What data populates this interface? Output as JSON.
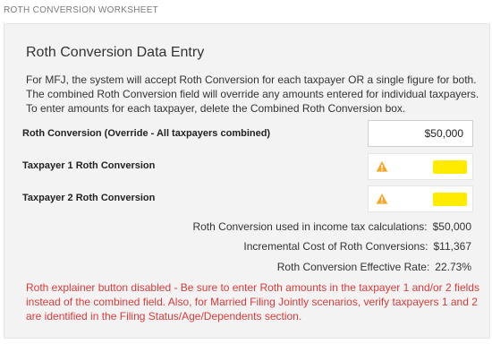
{
  "header": {
    "worksheet_title": "ROTH CONVERSION WORKSHEET"
  },
  "panel": {
    "title": "Roth Conversion Data Entry",
    "intro_lines": [
      "For MFJ, the system will accept Roth Conversion for each taxpayer OR a single figure for both.",
      "The combined Roth Conversion field will override any amounts entered for individual taxpayers.",
      "To enter amounts for each taxpayer, delete the Combined Roth Conversion box."
    ]
  },
  "fields": {
    "combined": {
      "label": "Roth Conversion (Override - All taxpayers combined)",
      "value": "$50,000"
    },
    "taxpayer1": {
      "label": "Taxpayer 1 Roth Conversion",
      "icon": "warning-icon",
      "highlight_color": "#ffeb00"
    },
    "taxpayer2": {
      "label": "Taxpayer 2 Roth Conversion",
      "icon": "warning-icon",
      "highlight_color": "#ffeb00"
    }
  },
  "summary": {
    "used": {
      "label": "Roth Conversion used in income tax calculations:",
      "value": "$50,000"
    },
    "incremental": {
      "label": "Incremental Cost of Roth Conversions:",
      "value": "$11,367"
    },
    "rate": {
      "label": "Roth Conversion Effective Rate:",
      "value": "22.73%"
    }
  },
  "error": {
    "lines": [
      "Roth explainer button disabled - Be sure to enter Roth amounts in the taxpayer 1 and/or 2 fields",
      "instead of the combined field. Also, for Married Filing Jointly scenarios, verify taxpayers 1 and 2",
      "are identified in the Filing Status/Age/Dependents section."
    ],
    "color": "#d93a3a"
  },
  "colors": {
    "warning": "#f5a623",
    "panel_bg": "#f3f3f3"
  }
}
